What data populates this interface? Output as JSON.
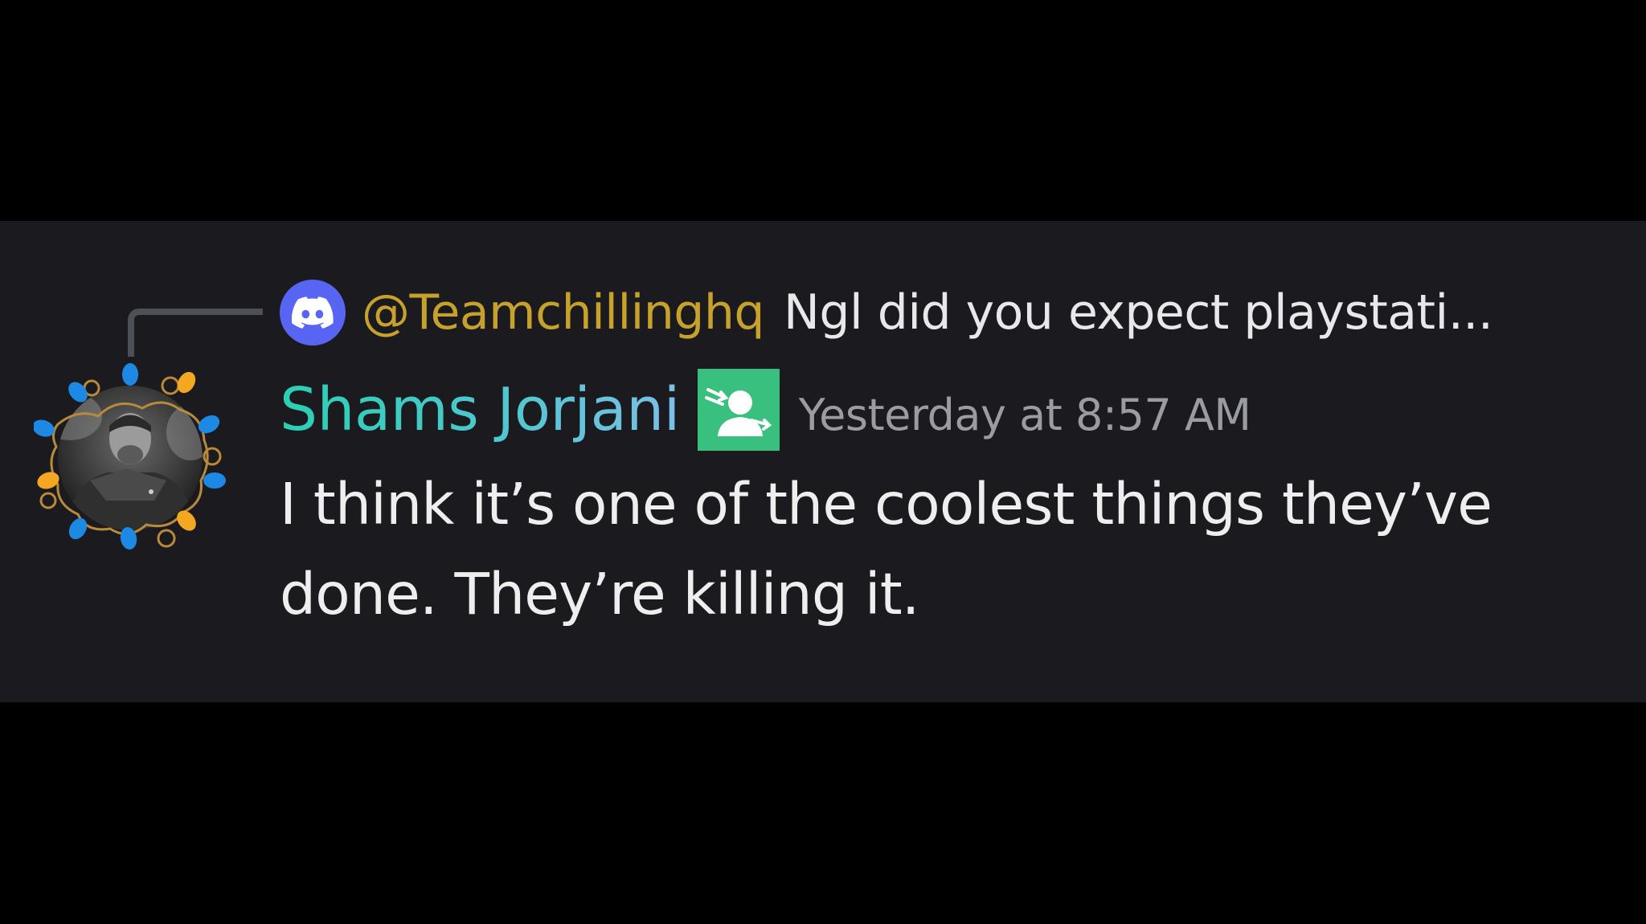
{
  "reply": {
    "author": "@Teamchillinghq",
    "preview": "Ngl did you expect playstati...",
    "avatar_icon": "discord-logo-icon"
  },
  "message": {
    "author": "Shams Jorjani",
    "role_icon": "person-arrows-icon",
    "timestamp": "Yesterday at 8:57 AM",
    "text": "I think it’s one of the coolest things they’ve done. They’re killing it."
  },
  "colors": {
    "panel_bg": "#1b1b1f",
    "reply_author": "#c6a12c",
    "author_gradient_start": "#2ad0b3",
    "author_gradient_end": "#7dbfe6",
    "role_badge": "#3ac07e",
    "discord_blurple": "#5865f2",
    "timestamp": "#9a9ca2"
  }
}
